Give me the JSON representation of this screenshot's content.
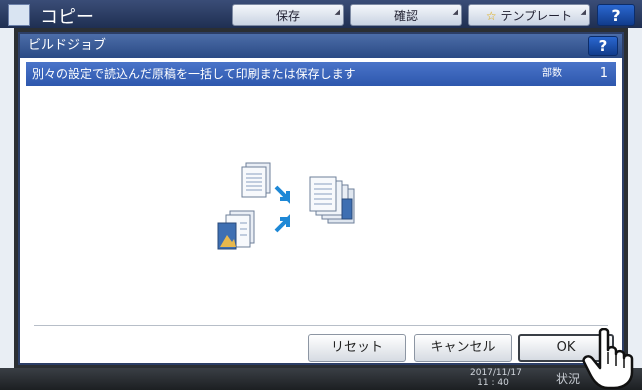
{
  "background": {
    "app_title": "コピー",
    "tabs": [
      "保存",
      "確認",
      "テンプレート"
    ],
    "help_label": "?",
    "clock_date": "2017/11/17",
    "clock_time": "11 : 40",
    "status_label": "状況"
  },
  "dialog": {
    "title": "ビルドジョブ",
    "help_label": "?",
    "info_text": "別々の設定で読込んだ原稿を一括して印刷または保存します",
    "copies_label": "部数",
    "copies_value": "1",
    "buttons": {
      "reset": "リセット",
      "cancel": "キャンセル",
      "ok": "OK"
    }
  },
  "colors": {
    "title_bar": "#2a4a85",
    "info_bar": "#2d57ad",
    "help_button": "#113c8c",
    "accent_arrow": "#1e88d6"
  }
}
